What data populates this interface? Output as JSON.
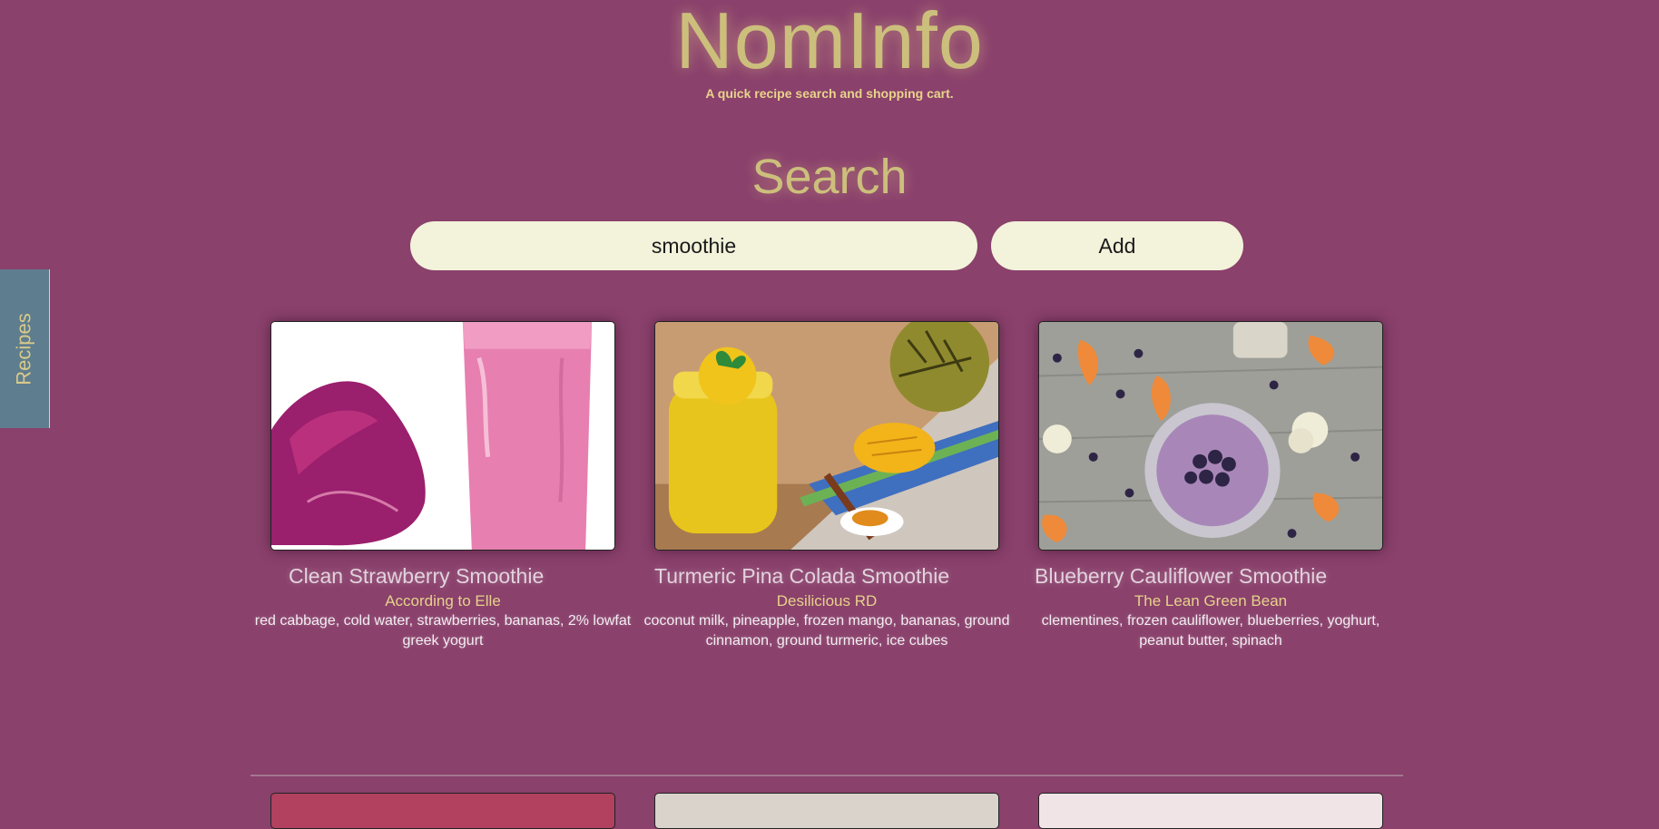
{
  "brand": {
    "title": "NomInfo",
    "tagline": "A quick recipe search and shopping cart."
  },
  "search": {
    "heading": "Search",
    "value": "smoothie",
    "button_label": "Add"
  },
  "sidebar": {
    "tab_label": "Recipes"
  },
  "recipes": [
    {
      "title": "Clean Strawberry Smoothie",
      "source": "According to Elle",
      "ingredients": "red cabbage, cold water, strawberries, bananas, 2% lowfat greek yogurt"
    },
    {
      "title": "Turmeric Pina Colada Smoothie",
      "source": "Desilicious RD",
      "ingredients": "coconut milk, pineapple, frozen mango, bananas, ground cinnamon, ground turmeric, ice cubes"
    },
    {
      "title": "Blueberry Cauliflower Smoothie",
      "source": "The Lean Green Bean",
      "ingredients": "clementines, frozen cauliflower, blueberries, yoghurt, peanut butter, spinach"
    }
  ],
  "colors": {
    "background": "#8a416c",
    "accent_gold": "#ccbf7c",
    "input_bg": "#f3f2da",
    "side_tab": "#5e7d8e"
  }
}
